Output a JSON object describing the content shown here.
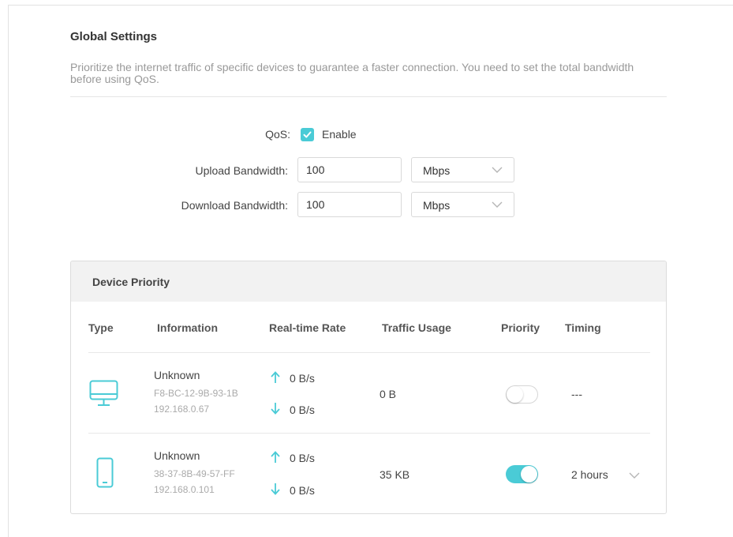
{
  "global": {
    "title": "Global Settings",
    "description": "Prioritize the internet traffic of specific devices to guarantee a faster connection. You need to set the total bandwidth before using QoS."
  },
  "form": {
    "qos_label": "QoS:",
    "qos_enabled": true,
    "enable_label": "Enable",
    "upload_label": "Upload Bandwidth:",
    "upload_value": "100",
    "upload_unit": "Mbps",
    "download_label": "Download Bandwidth:",
    "download_value": "100",
    "download_unit": "Mbps"
  },
  "device_priority": {
    "title": "Device Priority",
    "columns": [
      "Type",
      "Information",
      "Real-time Rate",
      "Traffic Usage",
      "Priority",
      "Timing"
    ],
    "rows": [
      {
        "type_icon": "desktop-icon",
        "name": "Unknown",
        "mac": "F8-BC-12-9B-93-1B",
        "ip": "192.168.0.67",
        "up_rate": "0 B/s",
        "down_rate": "0 B/s",
        "usage": "0 B",
        "priority_on": false,
        "timing": "---"
      },
      {
        "type_icon": "phone-icon",
        "name": "Unknown",
        "mac": "38-37-8B-49-57-FF",
        "ip": "192.168.0.101",
        "up_rate": "0 B/s",
        "down_rate": "0 B/s",
        "usage": "35 KB",
        "priority_on": true,
        "timing": "2 hours"
      }
    ]
  },
  "colors": {
    "accent": "#4acbd6",
    "text": "#333333",
    "muted": "#999999"
  }
}
